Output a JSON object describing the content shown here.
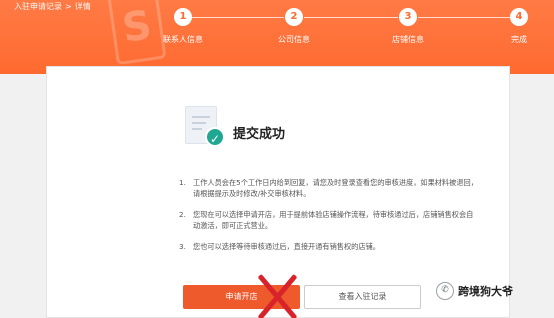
{
  "breadcrumb": [
    "入驻申请记录",
    ">",
    "详情"
  ],
  "steps": [
    {
      "num": "1",
      "label": "联系人信息"
    },
    {
      "num": "2",
      "label": "公司信息"
    },
    {
      "num": "3",
      "label": "店铺信息"
    },
    {
      "num": "4",
      "label": "完成"
    }
  ],
  "result": {
    "title": "提交成功",
    "notes": [
      {
        "num": "1.",
        "text": "工作人员会在5个工作日内给到回复，请您及时登录查看您的审核进度，如果材料被退回，请根据提示及时修改/补交审核材料。"
      },
      {
        "num": "2.",
        "text": "您现在可以选择申请开店，用于提前体验店铺操作流程，待审核通过后，店铺销售权会自动激活，即可正式营业。"
      },
      {
        "num": "3.",
        "text": "您也可以选择等待审核通过后，直接开通有销售权的店铺。"
      }
    ]
  },
  "actions": {
    "apply_label": "申请开店",
    "view_label": "查看入驻记录"
  },
  "watermark": {
    "icon_glyph": "✆",
    "text": "跨境狗大爷"
  },
  "colors": {
    "header": "#ff6a30",
    "primary_button": "#ee5a2c",
    "success": "#1fa792",
    "cross": "#d8232a"
  },
  "icons": [
    "success-document-icon",
    "check-icon",
    "red-cross-mark",
    "wechat-logo-icon"
  ]
}
